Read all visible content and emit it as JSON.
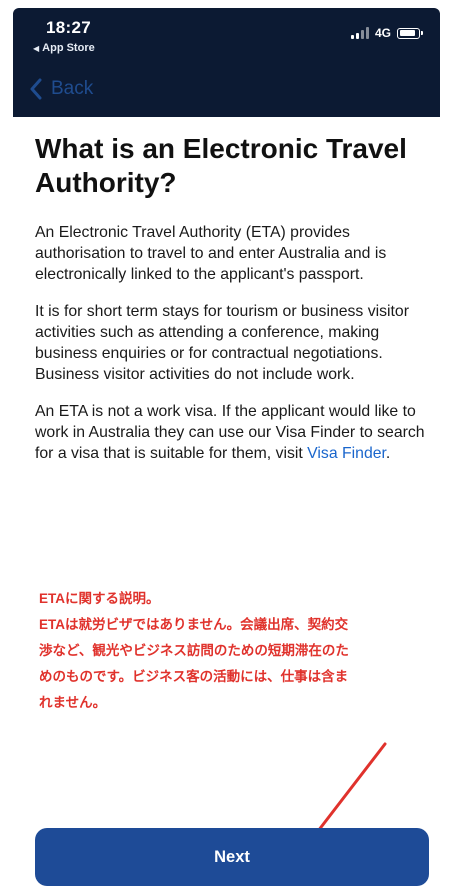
{
  "status_bar": {
    "time": "18:27",
    "back_app": "App Store",
    "network": "4G"
  },
  "nav": {
    "back_label": "Back"
  },
  "main": {
    "title": "What is an Electronic Travel Authority?",
    "paragraphs": {
      "p1": "An Electronic Travel Authority (ETA) provides authorisation to travel to and enter Australia and is electronically linked to the applicant's passport.",
      "p2": "It is for short term stays for tourism or business visitor activities such as attending a conference, making business enquiries or for contractual negotiations. Business visitor activities do not include work.",
      "p3_prefix": "An ETA is not a work visa. If the applicant would like to work in Australia they can use our Visa Finder to search for a visa that is suitable for them, visit ",
      "p3_link": "Visa Finder",
      "p3_suffix": "."
    }
  },
  "annotation": {
    "line1": "ETAに関する説明。",
    "line2": "ETAは就労ビザではありません。会議出席、契約交",
    "line3": "渉など、観光やビジネス訪問のための短期滞在のた",
    "line4": "めのものです。ビジネス客の活動には、仕事は含ま",
    "line5": "れません。",
    "color": "#e0322c"
  },
  "footer": {
    "next_label": "Next"
  },
  "colors": {
    "header_bg": "#0c1a33",
    "button_bg": "#1e4b97",
    "link": "#1a66cc"
  }
}
